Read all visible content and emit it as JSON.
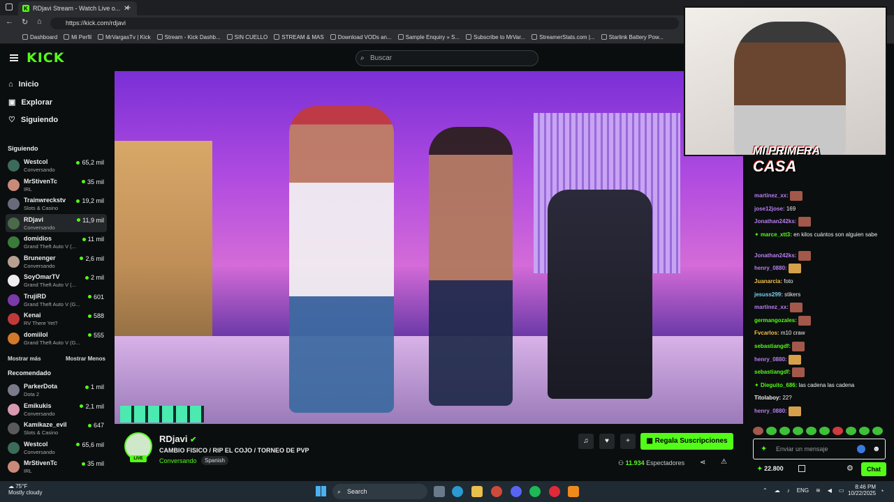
{
  "browser": {
    "tab_title": "RDjavi Stream - Watch Live o...",
    "url": "https://kick.com/rdjavi",
    "bookmarks": [
      "Dashboard",
      "Mi Perfil",
      "MrVargasTv | Kick",
      "Stream - Kick Dashb...",
      "SIN CUELLO",
      "STREAM & MAS",
      "Download VODs an...",
      "Sample Enquiry » S...",
      "Subscribe to MrVar...",
      "StreamerStats.com |...",
      "Starlink Battery Pow..."
    ]
  },
  "header": {
    "logo": "KICK",
    "search_placeholder": "Buscar"
  },
  "sidebar": {
    "nav": [
      "Inicio",
      "Explorar",
      "Siguiendo"
    ],
    "following_title": "Siguiendo",
    "following": [
      {
        "name": "Westcol",
        "category": "Conversando",
        "viewers": "65,2 mil",
        "color": "#3d6b5a"
      },
      {
        "name": "MrStivenTc",
        "category": "IRL",
        "viewers": "35 mil",
        "color": "#c98a7a"
      },
      {
        "name": "Trainwreckstv",
        "category": "Slots & Casino",
        "viewers": "19,2 mil",
        "color": "#6a6a7a"
      },
      {
        "name": "RDjavi",
        "category": "Conversando",
        "viewers": "11,9 mil",
        "color": "#4a6a4a"
      },
      {
        "name": "domidios",
        "category": "Grand Theft Auto V (...",
        "viewers": "11 mil",
        "color": "#3a7a3a"
      },
      {
        "name": "Brunenger",
        "category": "Conversando",
        "viewers": "2,6 mil",
        "color": "#b8a090"
      },
      {
        "name": "SoyOmarTV",
        "category": "Grand Theft Auto V (...",
        "viewers": "2 mil",
        "color": "#eeeeee"
      },
      {
        "name": "TrujiRD",
        "category": "Grand Theft Auto V (G...",
        "viewers": "601",
        "color": "#7a3aaa"
      },
      {
        "name": "Kenai",
        "category": "RV There Yet?",
        "viewers": "588",
        "color": "#c03a3a"
      },
      {
        "name": "domiilol",
        "category": "Grand Theft Auto V (G...",
        "viewers": "555",
        "color": "#d07a2a"
      }
    ],
    "show_more": "Mostrar más",
    "show_less": "Mostrar Menos",
    "recommended_title": "Recomendado",
    "recommended": [
      {
        "name": "ParkerDota",
        "category": "Dota 2",
        "viewers": "1 mil",
        "color": "#7a7a8a"
      },
      {
        "name": "Emikukis",
        "category": "Conversando",
        "viewers": "2,1 mil",
        "color": "#d89ab0"
      },
      {
        "name": "Kamikaze_evil",
        "category": "Slots & Casino",
        "viewers": "647",
        "color": "#5a5a5a"
      },
      {
        "name": "Westcol",
        "category": "Conversando",
        "viewers": "65,6 mil",
        "color": "#3d6b5a"
      },
      {
        "name": "MrStivenTc",
        "category": "IRL",
        "viewers": "35 mil",
        "color": "#c98a7a"
      }
    ]
  },
  "overlay": {
    "title_line1": "MI PRIMERA",
    "title_line2": "CASA"
  },
  "stream": {
    "channel": "RDjavi",
    "title": "CAMBIO FISICO / RIP EL COJO / TORNEO DE PVP",
    "category": "Conversando",
    "language": "Spanish",
    "live_label": "LIVE",
    "sub_button": "Regala Suscripciones",
    "viewers": "11.934",
    "viewers_label": "Espectadores"
  },
  "chat": {
    "messages": [
      {
        "user": "martinez_xx:",
        "text": "",
        "color": "#b77ef0",
        "emote": "face"
      },
      {
        "user": "jose12jose:",
        "text": "169",
        "color": "#b77ef0",
        "emote": ""
      },
      {
        "user": "Jonathan242ks:",
        "text": "",
        "color": "#b77ef0",
        "emote": "face"
      },
      {
        "user": "marce_xtt3:",
        "text": "en kilos cuántos son alguien sabe",
        "color": "#53fc18",
        "emote": ""
      },
      {
        "user": "Jonathan242ks:",
        "text": "",
        "color": "#b77ef0",
        "emote": "face"
      },
      {
        "user": "henry_0880:",
        "text": "",
        "color": "#b77ef0",
        "emote": "hand"
      },
      {
        "user": "Juanarcia:",
        "text": "foto",
        "color": "#f0c24a",
        "emote": ""
      },
      {
        "user": "jesuss299:",
        "text": "stikers",
        "color": "#7ad0f0",
        "emote": ""
      },
      {
        "user": "martinez_xx:",
        "text": "",
        "color": "#b77ef0",
        "emote": "face"
      },
      {
        "user": "germangozales:",
        "text": "",
        "color": "#53fc18",
        "emote": "face"
      },
      {
        "user": "Fvcarlos:",
        "text": "m10 craw",
        "color": "#f0c24a",
        "emote": ""
      },
      {
        "user": "sebastiangdf:",
        "text": "",
        "color": "#53fc18",
        "emote": "face"
      },
      {
        "user": "henry_0880:",
        "text": "",
        "color": "#b77ef0",
        "emote": "hand"
      },
      {
        "user": "sebastiangdf:",
        "text": "",
        "color": "#53fc18",
        "emote": "face"
      },
      {
        "user": "Dieguito_686:",
        "text": "las cadena las cadena",
        "color": "#53fc18",
        "emote": ""
      },
      {
        "user": "Titolaboy:",
        "text": "22?",
        "color": "#eeeeee",
        "emote": ""
      },
      {
        "user": "henry_0880:",
        "text": "",
        "color": "#b77ef0",
        "emote": "hand"
      }
    ],
    "input_placeholder": "Enviar un mensaje",
    "points": "22.800",
    "chat_button": "Chat"
  },
  "taskbar": {
    "weather_temp": "75°F",
    "weather_desc": "Mostly cloudy",
    "search": "Search",
    "lang": "ENG",
    "time": "8:46 PM",
    "date": "10/22/2025"
  }
}
